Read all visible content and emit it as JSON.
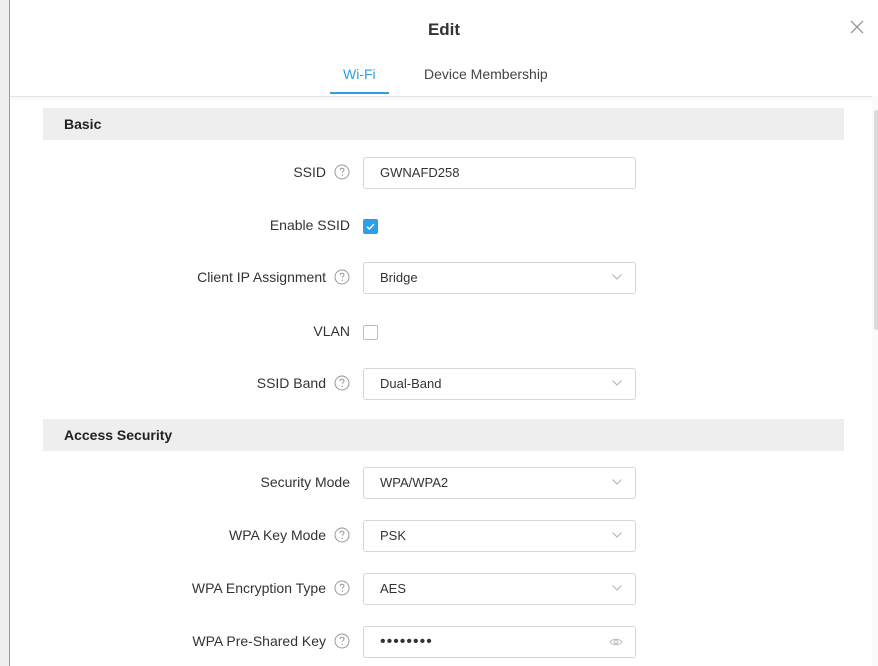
{
  "dialog": {
    "title": "Edit",
    "tabs": [
      {
        "label": "Wi-Fi",
        "active": true
      },
      {
        "label": "Device Membership",
        "active": false
      }
    ]
  },
  "sections": {
    "basic": "Basic",
    "access": "Access Security"
  },
  "fields": {
    "ssid": {
      "label": "SSID",
      "value": "GWNAFD258"
    },
    "enable_ssid": {
      "label": "Enable SSID",
      "checked": true
    },
    "client_ip": {
      "label": "Client IP Assignment",
      "value": "Bridge"
    },
    "vlan": {
      "label": "VLAN",
      "checked": false
    },
    "ssid_band": {
      "label": "SSID Band",
      "value": "Dual-Band"
    },
    "security_mode": {
      "label": "Security Mode",
      "value": "WPA/WPA2"
    },
    "wpa_key_mode": {
      "label": "WPA Key Mode",
      "value": "PSK"
    },
    "wpa_encryption": {
      "label": "WPA Encryption Type",
      "value": "AES"
    },
    "wpa_psk": {
      "label": "WPA Pre-Shared Key",
      "value": "••••••••"
    }
  },
  "icons": {
    "close": "close-icon",
    "help": "help-circle-icon",
    "chevron": "chevron-down-icon",
    "eye": "eye-icon",
    "check": "check-icon"
  },
  "colors": {
    "accent": "#2d9ee9",
    "section_bg": "#eeeeee",
    "border": "#d6d6d6"
  }
}
